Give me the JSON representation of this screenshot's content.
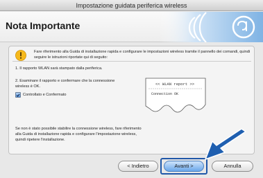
{
  "window": {
    "title": "Impostazione guidata periferica wireless"
  },
  "header": {
    "title": "Nota Importante"
  },
  "panel": {
    "intro_text": "Fare riferimento alla Guida di installazione rapida e configurare le impostazioni wireless tramite il pannello dei comandi, quindi seguire le istruzioni riportate qui di seguito:",
    "step1": "1. Il rapporto WLAN sarà stampato dalla periferica.",
    "step2": "2. Esaminare il rapporto e confermare che la connessione wireless è OK.",
    "checkbox": {
      "label": "Controllato e Confermato",
      "checked": true
    },
    "report_header": "<< WLAN report >>",
    "report_line": "Connection OK",
    "note": "Se non è stato possibile stabilire la connessione wireless, fare riferimento alla Guida di installazione rapida e configurare l'impostazione wireless, quindi ripetere l'installazione."
  },
  "buttons": {
    "back": "< Indietro",
    "next": "Avanti >",
    "cancel": "Annulla"
  },
  "icons": {
    "warning": "warning-icon",
    "brand_logo": "wireless-logo-icon",
    "arrow": "arrow-pointer-icon"
  },
  "colors": {
    "accent_blue": "#2a62b5",
    "arrow_blue": "#1f5fb0"
  }
}
